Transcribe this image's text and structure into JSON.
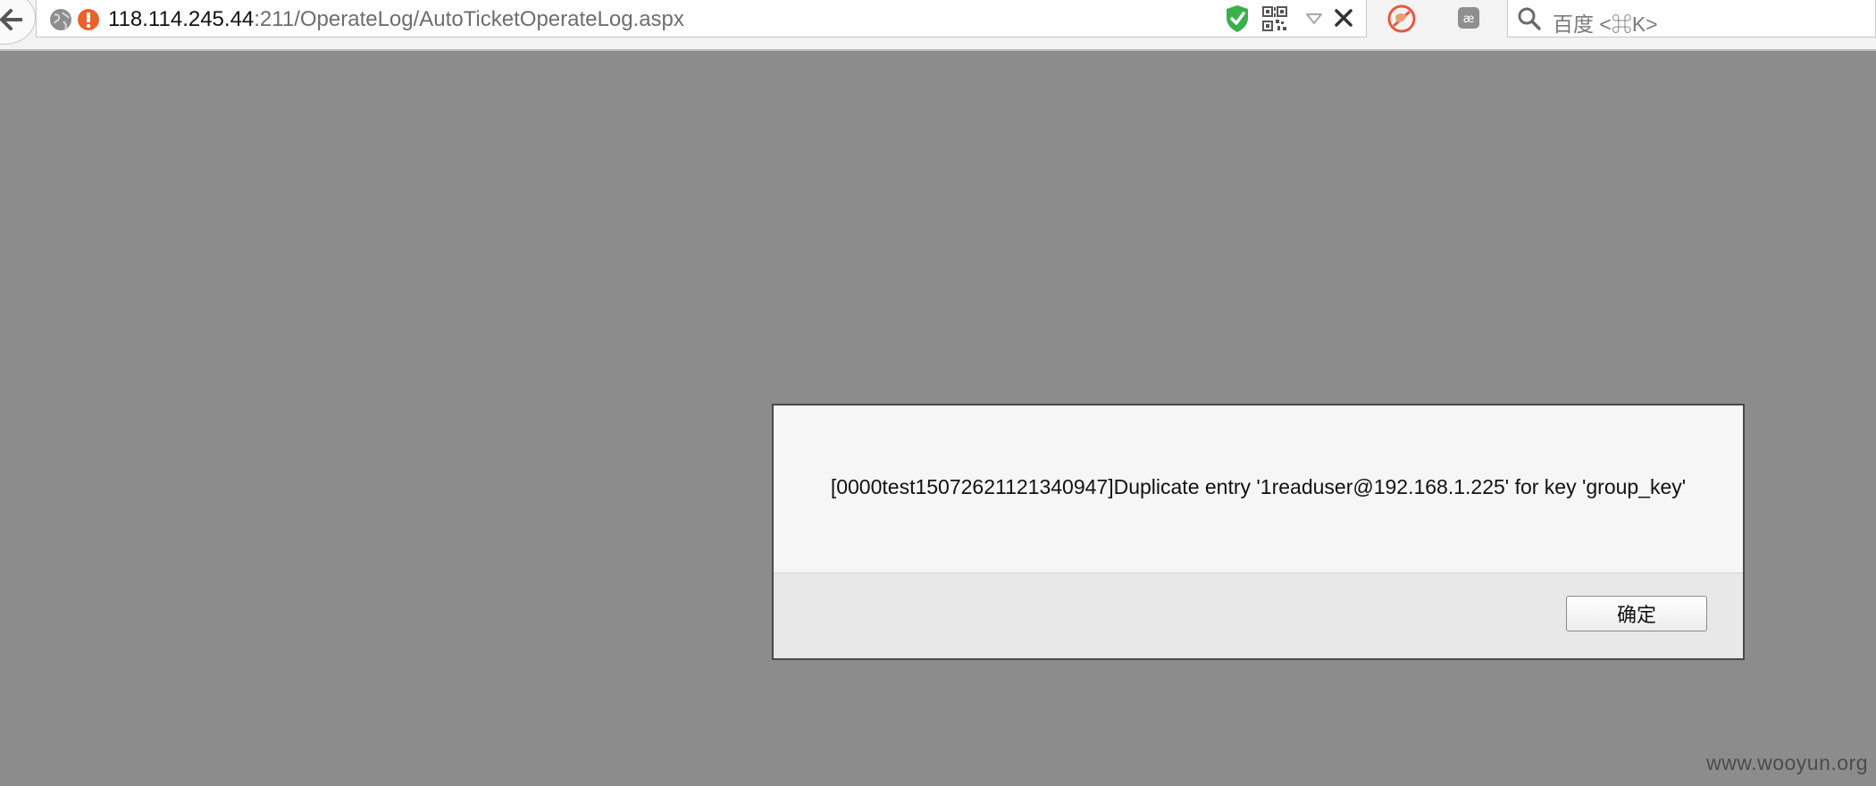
{
  "browser": {
    "url_host": "118.114.245.44",
    "url_rest": ":211/OperateLog/AutoTicketOperateLog.aspx",
    "search_placeholder": "百度 <⌘K>",
    "icons": [
      "back-arrow-icon",
      "globe-icon",
      "warning-icon",
      "shield-icon",
      "qr-code-icon",
      "dropmarker-icon",
      "close-icon",
      "adblock-icon",
      "reader-icon",
      "search-icon"
    ],
    "accent_colors": {
      "warning": "#e8622a",
      "shield": "#3bb04a",
      "adblock": "#e45a3c"
    }
  },
  "dialog": {
    "message": "[0000test15072621121340947]Duplicate entry '1readuser@192.168.1.225' for key 'group_key'",
    "ok_label": "确定"
  },
  "watermark": "www.wooyun.org"
}
